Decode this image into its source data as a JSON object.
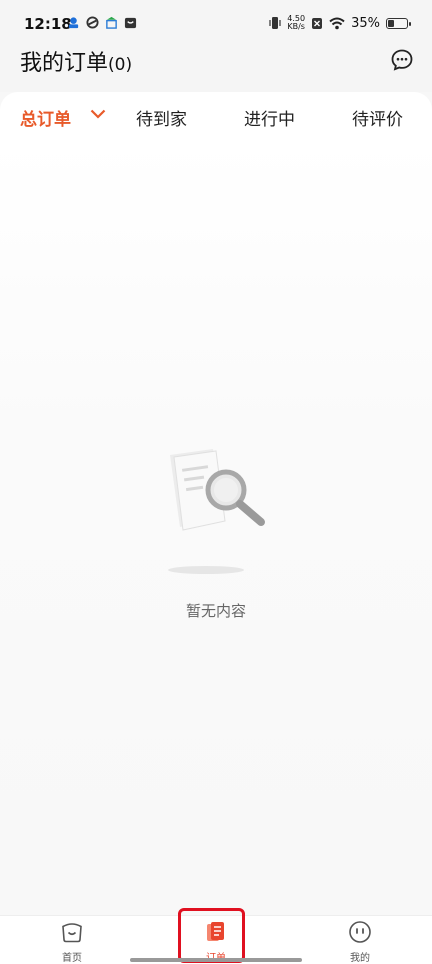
{
  "status_bar": {
    "time": "12:18",
    "net_speed_value": "4.50",
    "net_speed_unit": "KB/s",
    "battery_percent": "35%",
    "battery_level": 0.35,
    "left_icons": [
      "notification-app-icon",
      "sync-app-icon",
      "store-app-icon",
      "bag-app-icon"
    ],
    "right_icons": [
      "vibrate-icon",
      "sim-off-icon",
      "wifi-icon",
      "battery-icon"
    ]
  },
  "header": {
    "title": "我的订单",
    "count": "(0)",
    "chat_icon": "chat-bubble-icon"
  },
  "tabs": [
    {
      "label": "总订单",
      "active": true
    },
    {
      "label": "待到家",
      "active": false
    },
    {
      "label": "进行中",
      "active": false
    },
    {
      "label": "待评价",
      "active": false
    }
  ],
  "empty_state": {
    "text": "暂无内容",
    "icon": "document-search-icon"
  },
  "bottom_nav": [
    {
      "label": "首页",
      "icon": "home-bag-icon",
      "active": false
    },
    {
      "label": "订单",
      "icon": "order-icon",
      "active": true
    },
    {
      "label": "我的",
      "icon": "profile-face-icon",
      "active": false
    }
  ],
  "colors": {
    "accent": "#e85a2a",
    "nav_active": "#e8452e",
    "highlight": "#e01020"
  }
}
